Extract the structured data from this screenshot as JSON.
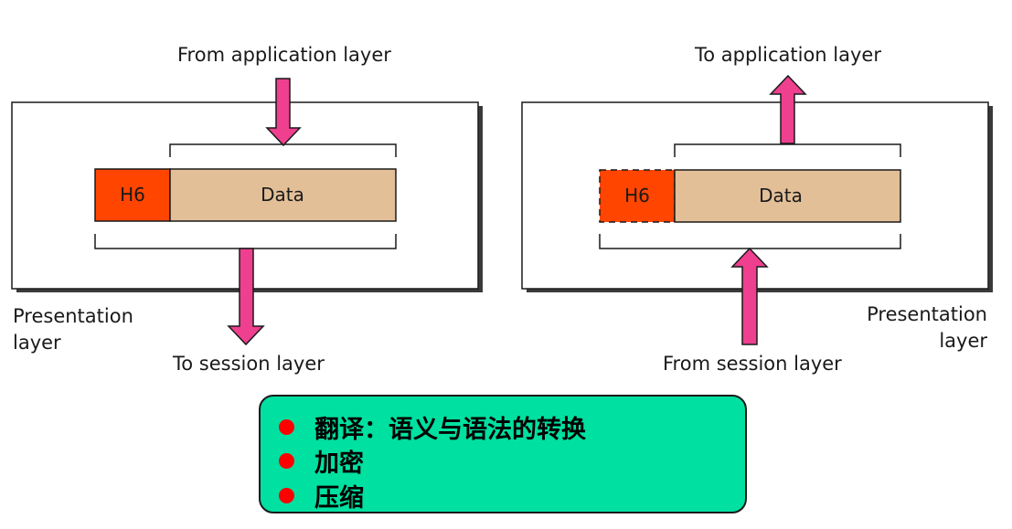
{
  "colors": {
    "arrow": "#ef3f8f",
    "header": "#ff4500",
    "data": "#e3bf98",
    "panel_bg": "#00e0a0",
    "bullet": "#ff0000",
    "frame_shadow": "#3a3a3a"
  },
  "sender": {
    "top_label": "From application layer",
    "header_label": "H6",
    "data_label": "Data",
    "bottom_label": "To session layer",
    "layer_label_line1": "Presentation",
    "layer_label_line2": "layer"
  },
  "receiver": {
    "top_label": "To application layer",
    "header_label": "H6",
    "data_label": "Data",
    "bottom_label": "From session layer",
    "layer_label_line1": "Presentation",
    "layer_label_line2": "layer"
  },
  "functions": {
    "items": [
      "翻译：语义与语法的转换",
      "加密",
      "压缩"
    ]
  }
}
